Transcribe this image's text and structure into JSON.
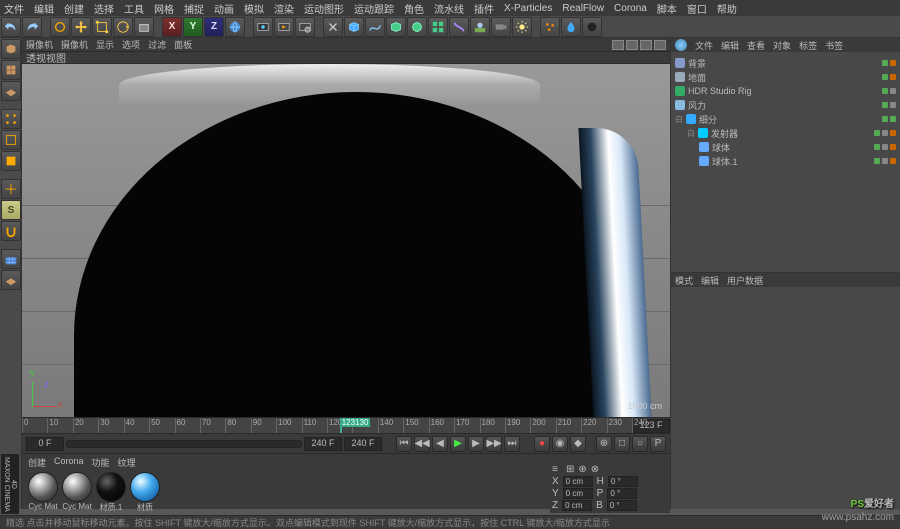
{
  "menu": [
    "文件",
    "编辑",
    "创建",
    "选择",
    "工具",
    "网格",
    "捕捉",
    "动画",
    "模拟",
    "渲染",
    "运动图形",
    "运动跟踪",
    "角色",
    "流水线",
    "插件",
    "X-Particles",
    "RealFlow",
    "Corona",
    "脚本",
    "窗口",
    "帮助"
  ],
  "viewHeader": {
    "cam": [
      "摄像机",
      "摄像机",
      "显示",
      "选项",
      "过滤",
      "面板"
    ],
    "title": "透视视图"
  },
  "scale": "1000 cm",
  "timeline": {
    "start": "0 F",
    "end": "240 F",
    "cur": "123 F",
    "endField": "240 F",
    "ticks": [
      "0",
      "10",
      "20",
      "30",
      "40",
      "50",
      "60",
      "70",
      "80",
      "90",
      "100",
      "110",
      "120",
      "130",
      "140",
      "150",
      "160",
      "170",
      "180",
      "190",
      "200",
      "210",
      "220",
      "230",
      "240"
    ],
    "playhead": 125,
    "marker": "123130"
  },
  "materials": {
    "tabs": [
      "创建",
      "Corona",
      "功能",
      "纹理"
    ],
    "items": [
      {
        "name": "Cyc Mat"
      },
      {
        "name": "Cyc Mat"
      },
      {
        "name": "材质.1"
      },
      {
        "name": "材质"
      }
    ]
  },
  "status": "精选  点击并移动鼠标移动元素。按住 SHIFT 键放大/缩放方式显示。双点编辑模式到现件 SHIFT 键放大/缩放方式显示，按住 CTRL 键放大/缩放方式显示",
  "objTabs": [
    "文件",
    "编辑",
    "查看",
    "对象",
    "标签",
    "书签"
  ],
  "tree": [
    {
      "ind": 0,
      "icon": "#89c",
      "name": "背景",
      "dots": [
        "#5a5",
        "#c60"
      ]
    },
    {
      "ind": 0,
      "icon": "#9ab",
      "name": "地面",
      "dots": [
        "#5a5",
        "#c60"
      ]
    },
    {
      "ind": 0,
      "icon": "#3a6",
      "name": "HDR Studio Rig",
      "dots": [
        "#5a5",
        "#888"
      ]
    },
    {
      "ind": 0,
      "icon": "#8bd",
      "name": "风力",
      "dots": [
        "#5a5",
        "#888"
      ]
    },
    {
      "ind": 0,
      "icon": "#3af",
      "name": "细分",
      "dots": [
        "#5a5",
        "#5a5"
      ],
      "exp": "白"
    },
    {
      "ind": 1,
      "icon": "#0cf",
      "name": "发射器",
      "dots": [
        "#5a5",
        "#888",
        "#c60"
      ],
      "exp": "白"
    },
    {
      "ind": 2,
      "icon": "#6af",
      "name": "球体",
      "dots": [
        "#5a5",
        "#888",
        "#c60"
      ]
    },
    {
      "ind": 2,
      "icon": "#6af",
      "name": "球体.1",
      "dots": [
        "#5a5",
        "#888",
        "#c60"
      ]
    }
  ],
  "attrTabs": [
    "模式",
    "编辑",
    "用户数据"
  ],
  "coords": {
    "labels": [
      "X",
      "Y",
      "Z",
      "H",
      "P",
      "B"
    ],
    "vals": [
      "0 cm",
      "0 cm",
      "0 cm",
      "0 °",
      "0 °",
      "0 °"
    ]
  },
  "watermark": {
    "t1a": "PS",
    "t1b": "爱好者",
    "t2": "www.psahz.com"
  },
  "maxon": "MAXON CINEMA 4D"
}
